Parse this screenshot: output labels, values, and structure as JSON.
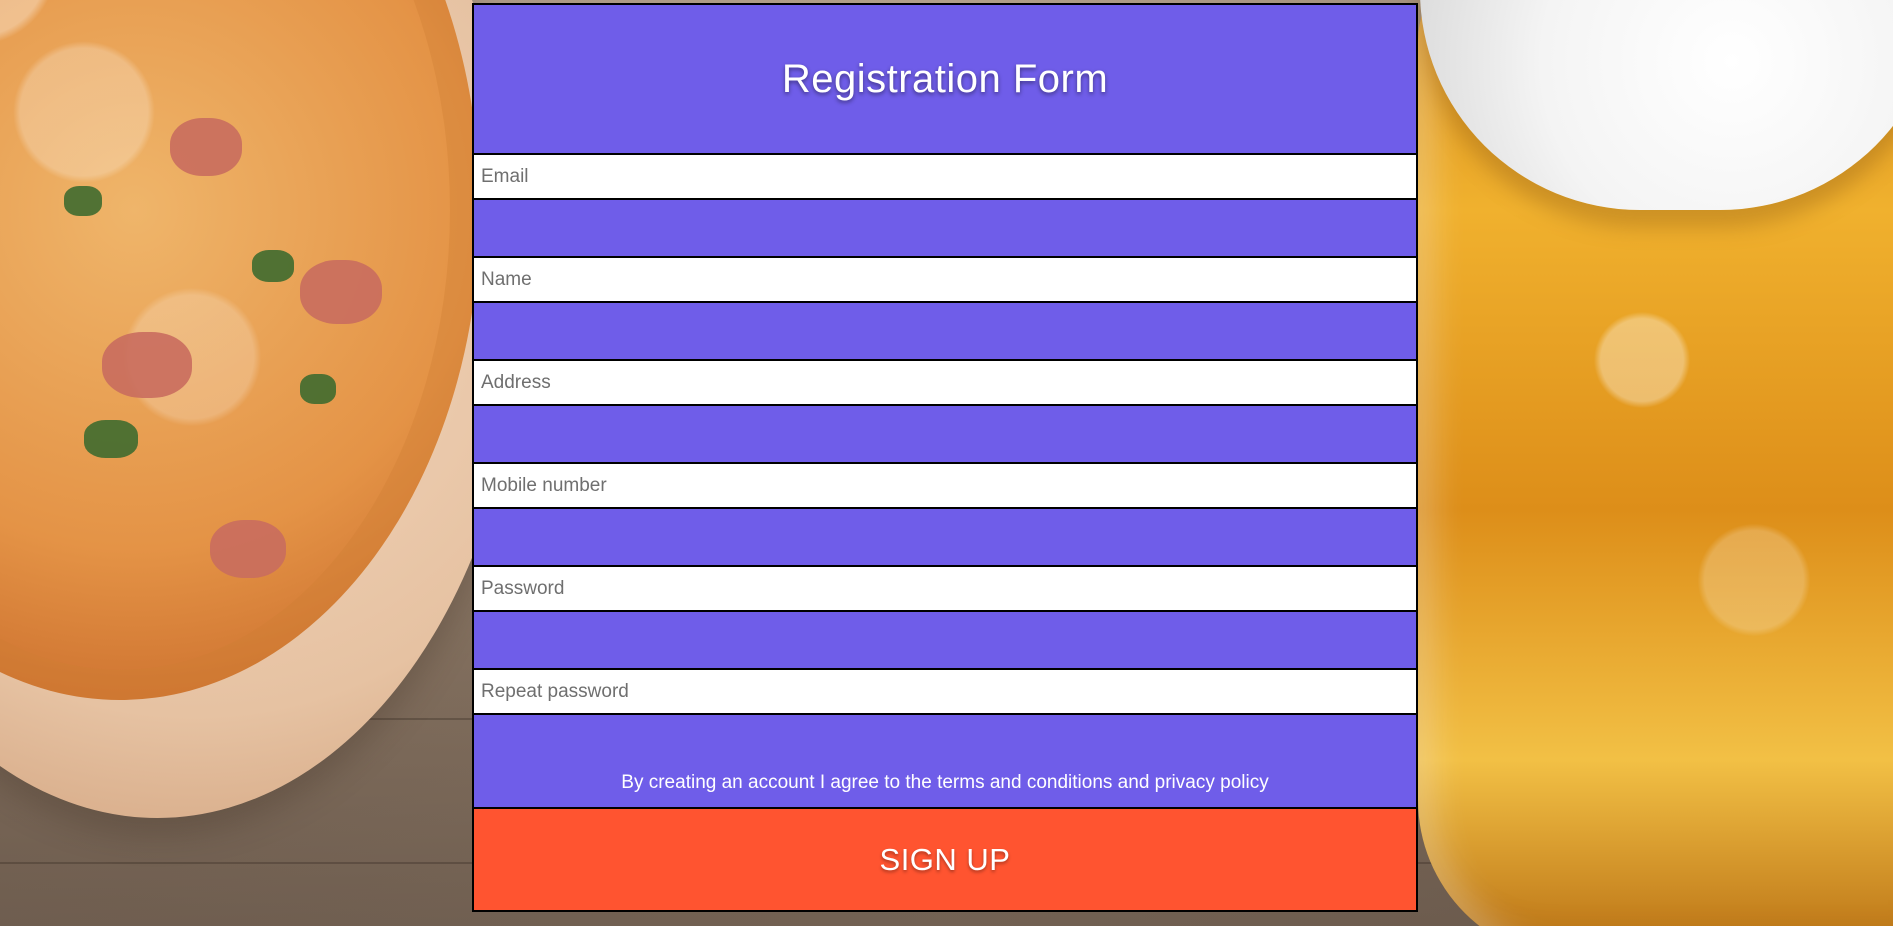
{
  "page": {
    "background": "photo-pizza-and-beer",
    "form_color": "#6f5de9",
    "button_color": "#ff5430"
  },
  "form": {
    "title": "Registration Form",
    "fields": [
      {
        "placeholder": "Email",
        "value": ""
      },
      {
        "placeholder": "Name",
        "value": ""
      },
      {
        "placeholder": "Address",
        "value": ""
      },
      {
        "placeholder": "Mobile number",
        "value": ""
      },
      {
        "placeholder": "Password",
        "value": ""
      },
      {
        "placeholder": "Repeat password",
        "value": ""
      }
    ],
    "terms_text": "By creating an account I agree to the terms and conditions and privacy policy",
    "submit_label": "SIGN UP"
  }
}
